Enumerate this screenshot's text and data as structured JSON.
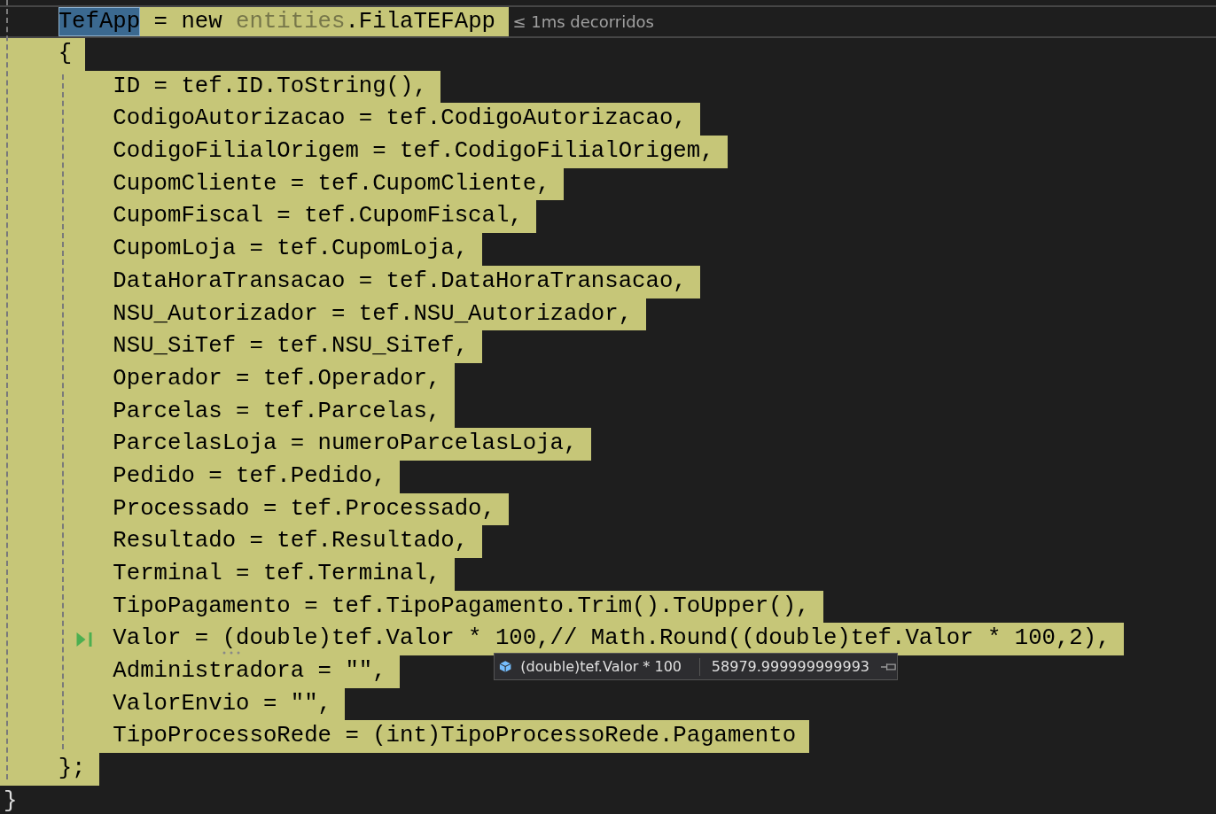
{
  "lines": [
    {
      "highlight": true,
      "indented": true,
      "parts": [
        {
          "kind": "selected",
          "text": "TefApp"
        },
        {
          "kind": "code",
          "text": " = new "
        },
        {
          "kind": "dim",
          "text": "entities"
        },
        {
          "kind": "code",
          "text": ".FilaTEFApp"
        }
      ],
      "perf_tip": "≤ 1ms decorridos"
    },
    {
      "highlight": true,
      "text": "    {"
    },
    {
      "highlight": true,
      "text": "        ID = tef.ID.ToString(),"
    },
    {
      "highlight": true,
      "text": "        CodigoAutorizacao = tef.CodigoAutorizacao,"
    },
    {
      "highlight": true,
      "text": "        CodigoFilialOrigem = tef.CodigoFilialOrigem,"
    },
    {
      "highlight": true,
      "text": "        CupomCliente = tef.CupomCliente,"
    },
    {
      "highlight": true,
      "text": "        CupomFiscal = tef.CupomFiscal,"
    },
    {
      "highlight": true,
      "text": "        CupomLoja = tef.CupomLoja,"
    },
    {
      "highlight": true,
      "text": "        DataHoraTransacao = tef.DataHoraTransacao,"
    },
    {
      "highlight": true,
      "text": "        NSU_Autorizador = tef.NSU_Autorizador,"
    },
    {
      "highlight": true,
      "text": "        NSU_SiTef = tef.NSU_SiTef,"
    },
    {
      "highlight": true,
      "text": "        Operador = tef.Operador,"
    },
    {
      "highlight": true,
      "text": "        Parcelas = tef.Parcelas,"
    },
    {
      "highlight": true,
      "text": "        ParcelasLoja = numeroParcelasLoja,"
    },
    {
      "highlight": true,
      "text": "        Pedido = tef.Pedido,"
    },
    {
      "highlight": true,
      "text": "        Processado = tef.Processado,"
    },
    {
      "highlight": true,
      "text": "        Resultado = tef.Resultado,"
    },
    {
      "highlight": true,
      "text": "        Terminal = tef.Terminal,"
    },
    {
      "highlight": true,
      "text": "        TipoPagamento = tef.TipoPagamento.Trim().ToUpper(),"
    },
    {
      "highlight": true,
      "run_to_click": true,
      "hint_dots": true,
      "text": "        Valor = (double)tef.Valor * 100,// Math.Round((double)tef.Valor * 100,2),"
    },
    {
      "highlight": true,
      "text": "        Administradora = \"\","
    },
    {
      "highlight": true,
      "text": "        ValorEnvio = \"\","
    },
    {
      "highlight": true,
      "text": "        TipoProcessoRede = (int)TipoProcessoRede.Pagamento"
    },
    {
      "highlight": true,
      "text": "    };"
    },
    {
      "highlight": false,
      "text": "}"
    }
  ],
  "datatip": {
    "expression": "(double)tef.Valor * 100",
    "value": "58979.999999999993"
  }
}
